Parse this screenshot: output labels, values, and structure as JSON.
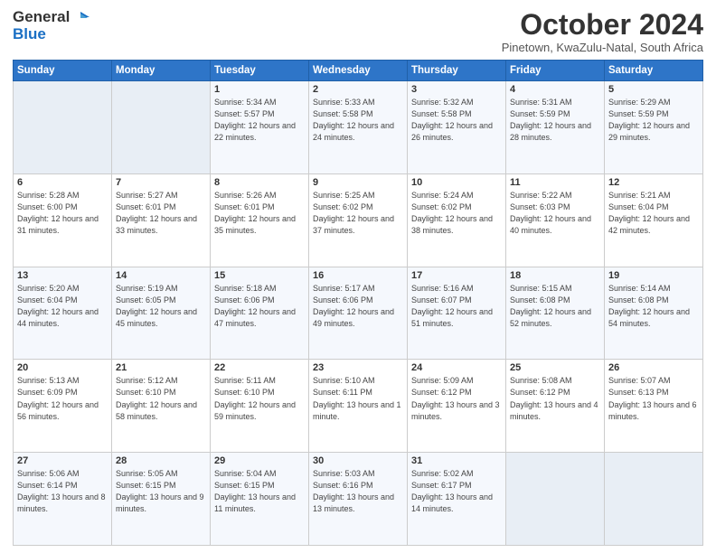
{
  "logo": {
    "general": "General",
    "blue": "Blue"
  },
  "header": {
    "month": "October 2024",
    "location": "Pinetown, KwaZulu-Natal, South Africa"
  },
  "weekdays": [
    "Sunday",
    "Monday",
    "Tuesday",
    "Wednesday",
    "Thursday",
    "Friday",
    "Saturday"
  ],
  "weeks": [
    [
      {
        "day": "",
        "info": ""
      },
      {
        "day": "",
        "info": ""
      },
      {
        "day": "1",
        "info": "Sunrise: 5:34 AM\nSunset: 5:57 PM\nDaylight: 12 hours\nand 22 minutes."
      },
      {
        "day": "2",
        "info": "Sunrise: 5:33 AM\nSunset: 5:58 PM\nDaylight: 12 hours\nand 24 minutes."
      },
      {
        "day": "3",
        "info": "Sunrise: 5:32 AM\nSunset: 5:58 PM\nDaylight: 12 hours\nand 26 minutes."
      },
      {
        "day": "4",
        "info": "Sunrise: 5:31 AM\nSunset: 5:59 PM\nDaylight: 12 hours\nand 28 minutes."
      },
      {
        "day": "5",
        "info": "Sunrise: 5:29 AM\nSunset: 5:59 PM\nDaylight: 12 hours\nand 29 minutes."
      }
    ],
    [
      {
        "day": "6",
        "info": "Sunrise: 5:28 AM\nSunset: 6:00 PM\nDaylight: 12 hours\nand 31 minutes."
      },
      {
        "day": "7",
        "info": "Sunrise: 5:27 AM\nSunset: 6:01 PM\nDaylight: 12 hours\nand 33 minutes."
      },
      {
        "day": "8",
        "info": "Sunrise: 5:26 AM\nSunset: 6:01 PM\nDaylight: 12 hours\nand 35 minutes."
      },
      {
        "day": "9",
        "info": "Sunrise: 5:25 AM\nSunset: 6:02 PM\nDaylight: 12 hours\nand 37 minutes."
      },
      {
        "day": "10",
        "info": "Sunrise: 5:24 AM\nSunset: 6:02 PM\nDaylight: 12 hours\nand 38 minutes."
      },
      {
        "day": "11",
        "info": "Sunrise: 5:22 AM\nSunset: 6:03 PM\nDaylight: 12 hours\nand 40 minutes."
      },
      {
        "day": "12",
        "info": "Sunrise: 5:21 AM\nSunset: 6:04 PM\nDaylight: 12 hours\nand 42 minutes."
      }
    ],
    [
      {
        "day": "13",
        "info": "Sunrise: 5:20 AM\nSunset: 6:04 PM\nDaylight: 12 hours\nand 44 minutes."
      },
      {
        "day": "14",
        "info": "Sunrise: 5:19 AM\nSunset: 6:05 PM\nDaylight: 12 hours\nand 45 minutes."
      },
      {
        "day": "15",
        "info": "Sunrise: 5:18 AM\nSunset: 6:06 PM\nDaylight: 12 hours\nand 47 minutes."
      },
      {
        "day": "16",
        "info": "Sunrise: 5:17 AM\nSunset: 6:06 PM\nDaylight: 12 hours\nand 49 minutes."
      },
      {
        "day": "17",
        "info": "Sunrise: 5:16 AM\nSunset: 6:07 PM\nDaylight: 12 hours\nand 51 minutes."
      },
      {
        "day": "18",
        "info": "Sunrise: 5:15 AM\nSunset: 6:08 PM\nDaylight: 12 hours\nand 52 minutes."
      },
      {
        "day": "19",
        "info": "Sunrise: 5:14 AM\nSunset: 6:08 PM\nDaylight: 12 hours\nand 54 minutes."
      }
    ],
    [
      {
        "day": "20",
        "info": "Sunrise: 5:13 AM\nSunset: 6:09 PM\nDaylight: 12 hours\nand 56 minutes."
      },
      {
        "day": "21",
        "info": "Sunrise: 5:12 AM\nSunset: 6:10 PM\nDaylight: 12 hours\nand 58 minutes."
      },
      {
        "day": "22",
        "info": "Sunrise: 5:11 AM\nSunset: 6:10 PM\nDaylight: 12 hours\nand 59 minutes."
      },
      {
        "day": "23",
        "info": "Sunrise: 5:10 AM\nSunset: 6:11 PM\nDaylight: 13 hours\nand 1 minute."
      },
      {
        "day": "24",
        "info": "Sunrise: 5:09 AM\nSunset: 6:12 PM\nDaylight: 13 hours\nand 3 minutes."
      },
      {
        "day": "25",
        "info": "Sunrise: 5:08 AM\nSunset: 6:12 PM\nDaylight: 13 hours\nand 4 minutes."
      },
      {
        "day": "26",
        "info": "Sunrise: 5:07 AM\nSunset: 6:13 PM\nDaylight: 13 hours\nand 6 minutes."
      }
    ],
    [
      {
        "day": "27",
        "info": "Sunrise: 5:06 AM\nSunset: 6:14 PM\nDaylight: 13 hours\nand 8 minutes."
      },
      {
        "day": "28",
        "info": "Sunrise: 5:05 AM\nSunset: 6:15 PM\nDaylight: 13 hours\nand 9 minutes."
      },
      {
        "day": "29",
        "info": "Sunrise: 5:04 AM\nSunset: 6:15 PM\nDaylight: 13 hours\nand 11 minutes."
      },
      {
        "day": "30",
        "info": "Sunrise: 5:03 AM\nSunset: 6:16 PM\nDaylight: 13 hours\nand 13 minutes."
      },
      {
        "day": "31",
        "info": "Sunrise: 5:02 AM\nSunset: 6:17 PM\nDaylight: 13 hours\nand 14 minutes."
      },
      {
        "day": "",
        "info": ""
      },
      {
        "day": "",
        "info": ""
      }
    ]
  ]
}
